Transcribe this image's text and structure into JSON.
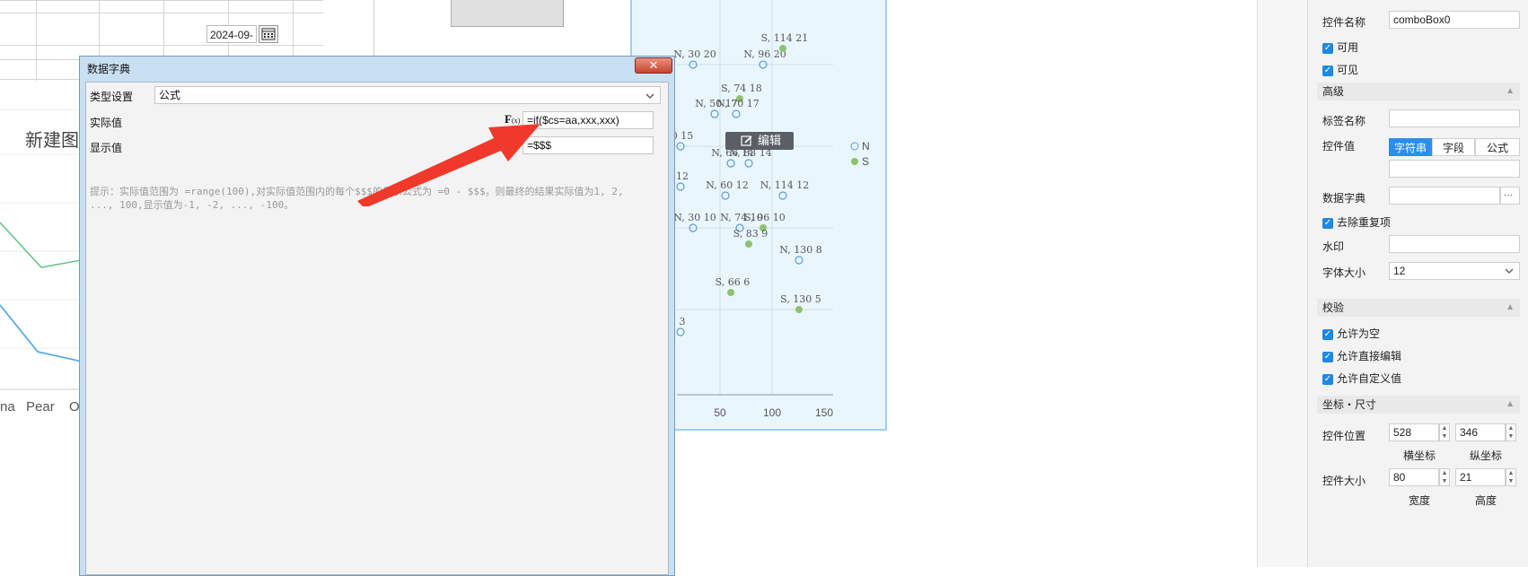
{
  "spreadsheet": {
    "date_value": "2024-09-"
  },
  "left_chart": {
    "title": "新建图",
    "x_labels": [
      "na",
      "Pear",
      "O"
    ]
  },
  "scatter": {
    "points": [
      {
        "label": "N, 30  20",
        "type": "N"
      },
      {
        "label": "N, 96  20",
        "type": "N"
      },
      {
        "label": "S, 114  21",
        "type": "S"
      },
      {
        "label": "S, 74  18",
        "type": "S"
      },
      {
        "label": "N, 50  17",
        "type": "N"
      },
      {
        "label": "N, 70  17",
        "type": "N"
      },
      {
        "label": "0  15",
        "type": "N"
      },
      {
        "label": "N, 66  14",
        "type": "N"
      },
      {
        "label": "N, 83  14",
        "type": "N"
      },
      {
        "label": "12",
        "type": "N"
      },
      {
        "label": "N, 60  12",
        "type": "N"
      },
      {
        "label": "N, 114  12",
        "type": "N"
      },
      {
        "label": "N, 30  10",
        "type": "N"
      },
      {
        "label": "N, 74  10",
        "type": "N"
      },
      {
        "label": "S, 96  10",
        "type": "S"
      },
      {
        "label": "S, 83  9",
        "type": "S"
      },
      {
        "label": "N, 130  8",
        "type": "N"
      },
      {
        "label": "S, 66  6",
        "type": "S"
      },
      {
        "label": "S, 130  5",
        "type": "S"
      },
      {
        "label": "3",
        "type": "N"
      }
    ],
    "x_ticks": [
      "50",
      "100",
      "150"
    ],
    "legend": [
      "N",
      "S"
    ],
    "colors": {
      "N": "#5b9bd5",
      "S": "#8dc26f"
    },
    "edit_label": "编辑"
  },
  "dialog": {
    "title": "数据字典",
    "type_label": "类型设置",
    "type_value": "公式",
    "actual_label": "实际值",
    "actual_formula": "=if($cs=aa,xxx,xxx)",
    "display_label": "显示值",
    "display_formula": "=$$$",
    "fx_label": "F",
    "fx_sub": "(x)",
    "hint": "提示：实际值范围为 =range(100),对实际值范围内的每个$$$的显示公式为 =0 - $$$，则最终的结果实际值为1, 2, ..., 100,显示值为-1, -2, ..., -100。",
    "close_glyph": "✕"
  },
  "properties": {
    "control_name_label": "控件名称",
    "control_name_value": "comboBox0",
    "enabled_label": "可用",
    "visible_label": "可见",
    "advanced_section": "高级",
    "tag_name_label": "标签名称",
    "tag_name_value": "",
    "control_value_label": "控件值",
    "value_tabs": [
      "字符串",
      "字段",
      "公式"
    ],
    "value_tab_active": 0,
    "data_dict_label": "数据字典",
    "data_dict_btn": "···",
    "dedupe_label": "去除重复项",
    "watermark_label": "水印",
    "font_size_label": "字体大小",
    "font_size_value": "12",
    "validation_section": "校验",
    "allow_empty_label": "允许为空",
    "allow_direct_edit_label": "允许直接编辑",
    "allow_custom_value_label": "允许自定义值",
    "coord_section": "坐标・尺寸",
    "position_label": "控件位置",
    "pos_x": "528",
    "pos_y": "346",
    "x_caption": "横坐标",
    "y_caption": "纵坐标",
    "size_label": "控件大小",
    "width": "80",
    "height": "21",
    "width_caption": "宽度",
    "height_caption": "高度"
  }
}
